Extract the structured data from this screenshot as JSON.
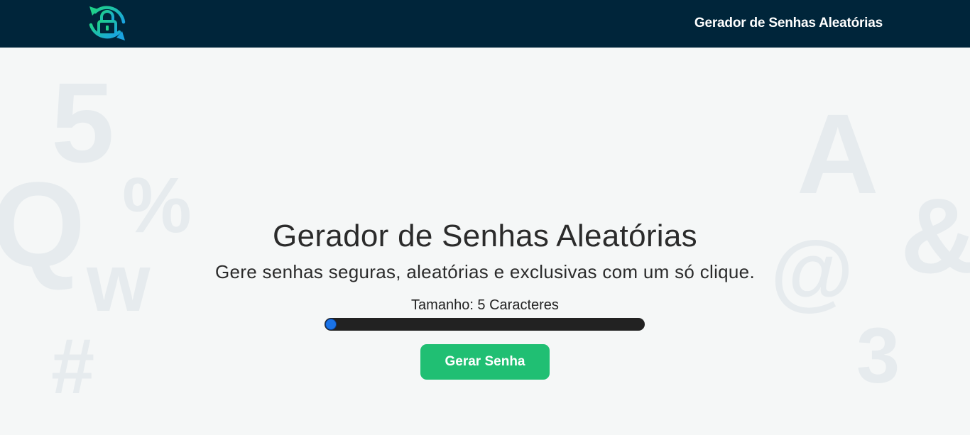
{
  "header": {
    "logo_icon": "padlock-refresh-icon",
    "nav_title": "Gerador de Senhas Aleatórias"
  },
  "background_glyphs": [
    {
      "name": "bg-glyph-5",
      "char": "5"
    },
    {
      "name": "bg-glyph-percent",
      "char": "%"
    },
    {
      "name": "bg-glyph-q",
      "char": "Q"
    },
    {
      "name": "bg-glyph-w",
      "char": "w"
    },
    {
      "name": "bg-glyph-hash",
      "char": "#"
    },
    {
      "name": "bg-glyph-a",
      "char": "A"
    },
    {
      "name": "bg-glyph-at",
      "char": "@"
    },
    {
      "name": "bg-glyph-ampersand",
      "char": "&"
    },
    {
      "name": "bg-glyph-3",
      "char": "3"
    }
  ],
  "main": {
    "title": "Gerador de Senhas Aleatórias",
    "subtitle": "Gere senhas seguras, aleatórias e exclusivas com um só clique.",
    "length_label": "Tamanho: 5 Caracteres",
    "slider_fraction": 0.0,
    "button_label": "Gerar Senha"
  },
  "colors": {
    "header_bg": "#00253a",
    "accent_green": "#20bf73",
    "slider_thumb": "#1a73e8",
    "logo_gradient_start": "#1fd08a",
    "logo_gradient_end": "#1aa3e0"
  }
}
